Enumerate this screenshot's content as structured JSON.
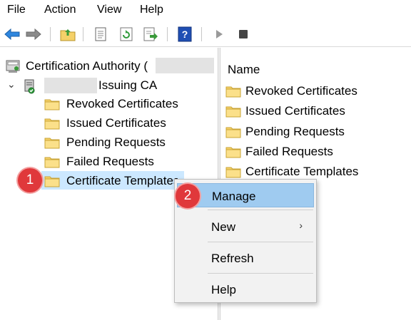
{
  "menu": [
    "File",
    "Action",
    "View",
    "Help"
  ],
  "tree": {
    "root_label": "Certification Authority (",
    "ca_label": "Issuing CA",
    "children": [
      "Revoked Certificates",
      "Issued Certificates",
      "Pending Requests",
      "Failed Requests",
      "Certificate Templates"
    ]
  },
  "list": {
    "column_name": "Name",
    "items": [
      "Revoked Certificates",
      "Issued Certificates",
      "Pending Requests",
      "Failed Requests",
      "Certificate Templates"
    ]
  },
  "context_menu": {
    "items": [
      "Manage",
      "New",
      "Refresh",
      "Help"
    ],
    "submenu_arrow": "›"
  },
  "callouts": [
    "1",
    "2"
  ],
  "colors": {
    "selection": "#cce8ff",
    "menu_highlight": "#9fcbf0",
    "callout": "#e0383b",
    "folder": "#f5d169"
  }
}
